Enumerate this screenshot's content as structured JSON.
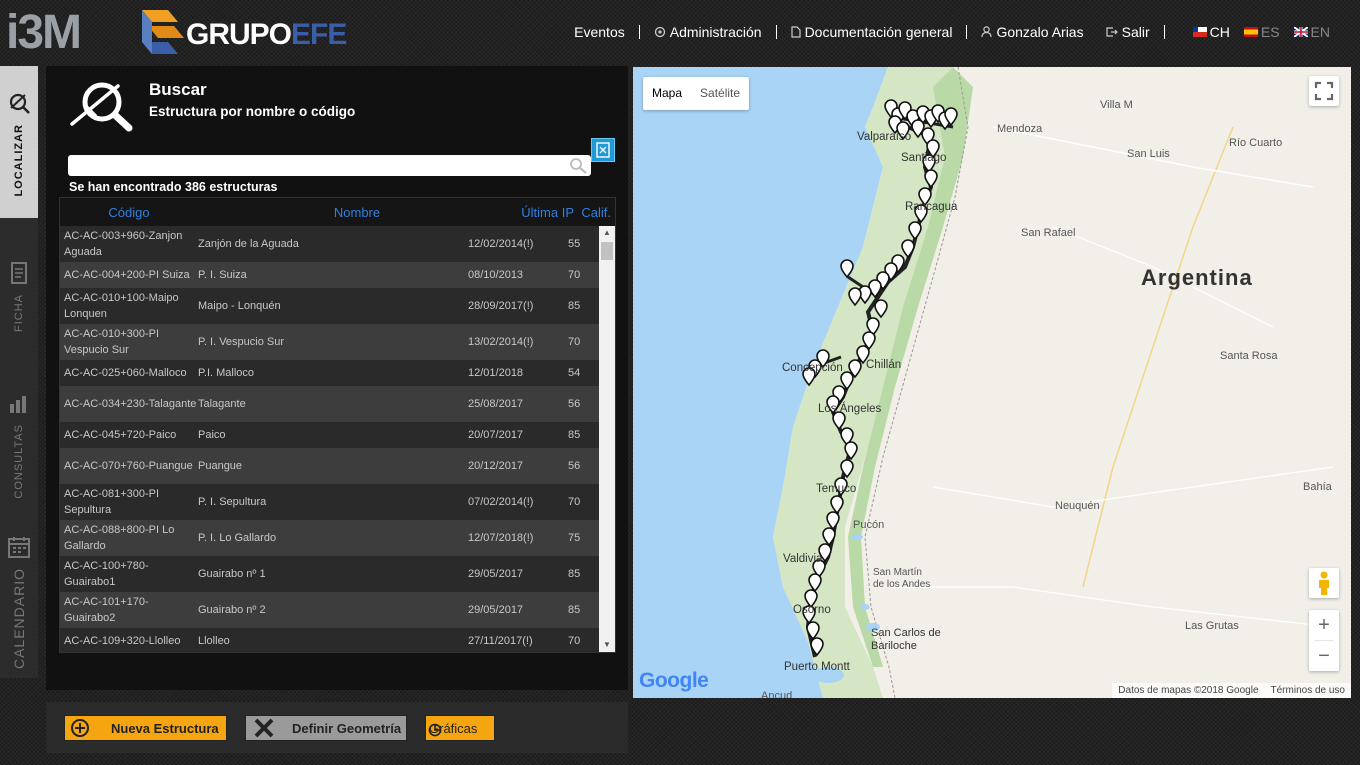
{
  "header": {
    "logo_left": "i3M",
    "logo_right_a": "GRUPO",
    "logo_right_b": "EFE",
    "nav": {
      "eventos": "Eventos",
      "administracion": "Administración",
      "documentacion": "Documentación general",
      "user": "Gonzalo Arias",
      "salir": "Salir"
    },
    "languages": [
      {
        "code": "CH",
        "active": true
      },
      {
        "code": "ES",
        "active": false
      },
      {
        "code": "EN",
        "active": false
      }
    ]
  },
  "sidebar": {
    "tabs": [
      {
        "label": "LOCALIZAR",
        "icon": "locate-icon",
        "active": true
      },
      {
        "label": "FICHA",
        "icon": "document-icon",
        "active": false
      },
      {
        "label": "CONSULTAS",
        "icon": "bar-chart-icon",
        "active": false
      },
      {
        "label": "CALENDARIO",
        "icon": "calendar-icon",
        "active": false
      }
    ]
  },
  "search": {
    "title": "Buscar",
    "subtitle": "Estructura por nombre o código",
    "input_value": "",
    "input_placeholder": "",
    "result_count": "Se han encontrado 386 estructuras"
  },
  "table": {
    "columns": [
      "Código",
      "Nombre",
      "Última IP",
      "Calif."
    ],
    "rows": [
      {
        "codigo": "AC-AC-003+960-Zanjon Aguada",
        "nombre": "Zanjón de la Aguada",
        "ip": "12/02/2014(!)",
        "calif": "55"
      },
      {
        "codigo": "AC-AC-004+200-PI Suiza",
        "nombre": "P. I. Suiza",
        "ip": "08/10/2013",
        "calif": "70"
      },
      {
        "codigo": "AC-AC-010+100-Maipo Lonquen",
        "nombre": "Maipo - Lonquén",
        "ip": "28/09/2017(!)",
        "calif": "85"
      },
      {
        "codigo": "AC-AC-010+300-PI Vespucio Sur",
        "nombre": "P. I. Vespucio Sur",
        "ip": "13/02/2014(!)",
        "calif": "70"
      },
      {
        "codigo": "AC-AC-025+060-Malloco",
        "nombre": "P.I. Malloco",
        "ip": "12/01/2018",
        "calif": "54"
      },
      {
        "codigo": "AC-AC-034+230-Talagante",
        "nombre": "Talagante",
        "ip": "25/08/2017",
        "calif": "56"
      },
      {
        "codigo": "AC-AC-045+720-Paico",
        "nombre": "Paico",
        "ip": "20/07/2017",
        "calif": "85"
      },
      {
        "codigo": "AC-AC-070+760-Puangue",
        "nombre": "Puangue",
        "ip": "20/12/2017",
        "calif": "56"
      },
      {
        "codigo": "AC-AC-081+300-PI Sepultura",
        "nombre": "P. I. Sepultura",
        "ip": "07/02/2014(!)",
        "calif": "70"
      },
      {
        "codigo": "AC-AC-088+800-PI Lo Gallardo",
        "nombre": "P. I. Lo Gallardo",
        "ip": "12/07/2018(!)",
        "calif": "75"
      },
      {
        "codigo": "AC-AC-100+780-Guairabo1",
        "nombre": "Guairabo nº 1",
        "ip": "29/05/2017",
        "calif": "85"
      },
      {
        "codigo": "AC-AC-101+170-Guairabo2",
        "nombre": "Guairabo nº 2",
        "ip": "29/05/2017",
        "calif": "85"
      },
      {
        "codigo": "AC-AC-109+320-Llolleo",
        "nombre": "Llolleo",
        "ip": "27/11/2017(!)",
        "calif": "70"
      }
    ]
  },
  "actions": {
    "new_structure": "Nueva Estructura",
    "define_geometry": "Definir Geometría",
    "charts": "Gráficas"
  },
  "map": {
    "type_options": [
      "Mapa",
      "Satélite"
    ],
    "selected_type": "Mapa",
    "country_label": "Argentina",
    "cities": [
      "Mendoza",
      "San Luis",
      "Río Cuarto",
      "San Rafael",
      "Santa Rosa",
      "Neuquén",
      "Bahía",
      "Santiago",
      "Rancagua",
      "Valparaíso",
      "Concepción",
      "Chillán",
      "Los Ángeles",
      "Temuco",
      "Pucón",
      "Valdivia",
      "Osorno",
      "Puerto Montt",
      "San Martín de los Andes",
      "San Carlos de Bariloche",
      "Las Grutas",
      "Villa M",
      "Ancud"
    ],
    "zoom_in": "+",
    "zoom_out": "−",
    "google": "Google",
    "attribution": "Datos de mapas ©2018 Google",
    "terms": "Términos de uso"
  },
  "colors": {
    "accent_orange": "#f5a50f",
    "link_blue": "#2f7fe0",
    "export_blue": "#1f9ad6"
  }
}
